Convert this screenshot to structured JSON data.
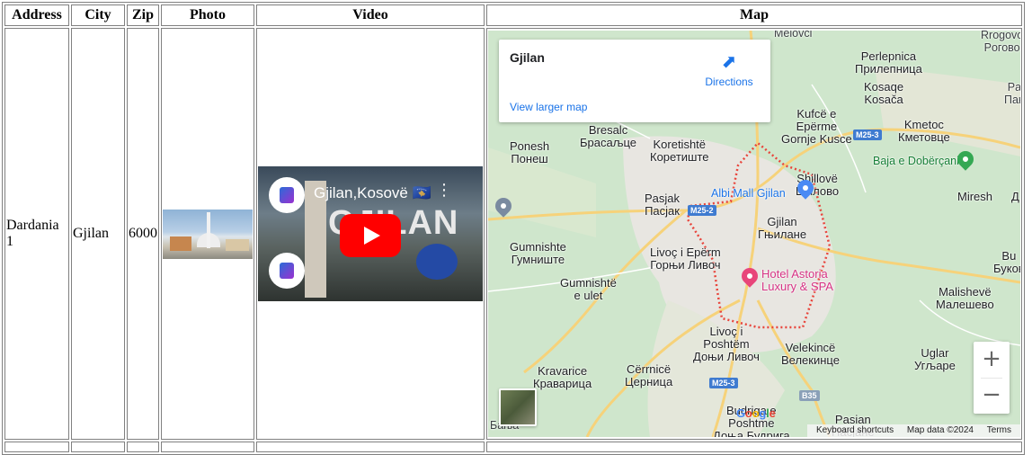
{
  "headers": [
    "Address",
    "City",
    "Zip",
    "Photo",
    "Video",
    "Map"
  ],
  "row": {
    "address": "Dardania 1",
    "city": "Gjilan",
    "zip": "6000",
    "photo_alt": "Gjilan mosque photo",
    "video": {
      "title": "Gjilan,Kosovë 🇽🇰",
      "big_text": "GJILAN",
      "menu_icon": "kebab-menu-icon",
      "play_icon": "youtube-play-icon"
    }
  },
  "map": {
    "card": {
      "place_name": "Gjilan",
      "directions_label": "Directions",
      "view_larger": "View larger map"
    },
    "labels": {
      "melovci": "Melovci",
      "rogovo": "Rrogovo\nPoгово",
      "perlepnica": "Perlepnica\nПрилепница",
      "kosace": "Kosaqe\nKosača",
      "pa": "Pa\nПан",
      "kufce": "Kufcë e\nEpërme\nGornje Kusce",
      "kmetoc": "Kmetoc\nКметовце",
      "bresalc": "Bresalc\nБрасаљце",
      "ponesh": "Ponesh\nПонеш",
      "koretishte": "Koretishtë\nКоретиште",
      "baja": "Baja e Dobërçanit",
      "shillove": "Shillovë\nШилово",
      "miresh": "Miresh",
      "d": "Д",
      "pasjak": "Pasjak\nПасјак",
      "albi": "Albi Mall Gjilan",
      "gjilan": "Gjilan\nГњилане",
      "gumnishte": "Gumnishte\nГумниште",
      "livoc_upper": "Livoç i Epërm\nГорњи Ливоч",
      "bu": "Bu\nБуков",
      "gumnishte_ulet": "Gumnishtë\ne ulet",
      "hotel": "Hotel Astoria\nLuxury & SPA",
      "malisheve": "Malishevë\nМалешево",
      "livoc_poshtem": "Livoç i\nPoshtëm\nДоњи Ливоч",
      "velekince": "Velekincë\nВелекинце",
      "uglar": "Uglar\nУгљаре",
      "kravarice": "Kravarice\nКраварица",
      "cernice": "Cërrnicë\nЦерница",
      "budriga": "Budriga e\nPoshtme\nДоња Будрига",
      "pasian": "Pasian\nПасјане",
      "banja": "Бања"
    },
    "shields": [
      "M25-3",
      "M25-2",
      "M25-3",
      "B35"
    ],
    "zoom_in": "+",
    "zoom_out": "−",
    "google": [
      "G",
      "o",
      "o",
      "g",
      "l",
      "e"
    ],
    "attribution": {
      "shortcuts": "Keyboard shortcuts",
      "data": "Map data ©2024",
      "terms": "Terms"
    },
    "colors": {
      "boundary": "#e8453c",
      "road": "#f6d27a",
      "urban": "#e8e6e1",
      "green": "#cfe6cc"
    }
  }
}
